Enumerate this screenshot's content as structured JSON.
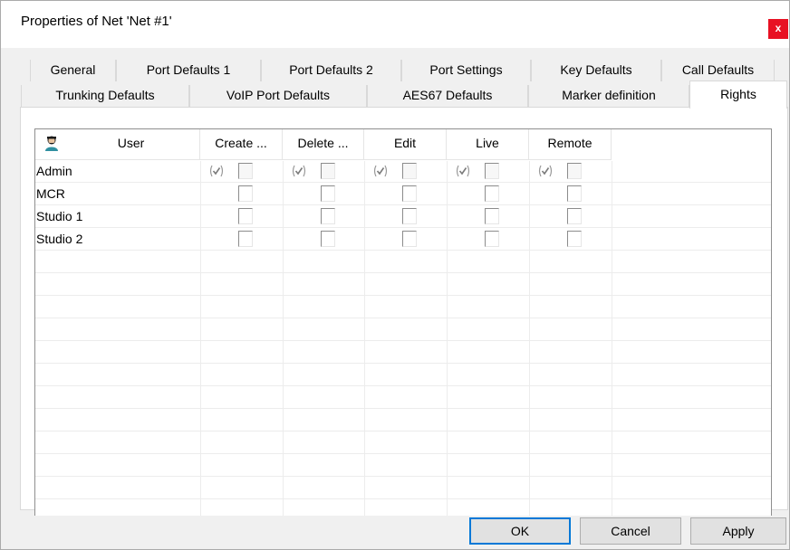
{
  "window": {
    "title": "Properties of Net 'Net #1'",
    "close_label": "x"
  },
  "tabs": {
    "row1": [
      "General",
      "Port Defaults 1",
      "Port Defaults 2",
      "Port Settings",
      "Key Defaults",
      "Call Defaults"
    ],
    "row2": [
      "Trunking Defaults",
      "VoIP Port Defaults",
      "AES67 Defaults",
      "Marker definition"
    ],
    "active": "Rights"
  },
  "rights_table": {
    "headers": [
      "User",
      "Create ...",
      "Delete ...",
      "Edit",
      "Live",
      "Remote"
    ],
    "header_icon": "user-icon",
    "rows": [
      {
        "user": "Admin",
        "inherited": [
          true,
          true,
          true,
          true,
          true
        ],
        "checked": [
          false,
          false,
          false,
          false,
          false
        ],
        "enabled": [
          false,
          false,
          false,
          false,
          false
        ]
      },
      {
        "user": "MCR",
        "inherited": [
          false,
          false,
          false,
          false,
          false
        ],
        "checked": [
          false,
          false,
          false,
          false,
          false
        ],
        "enabled": [
          true,
          true,
          true,
          true,
          true
        ]
      },
      {
        "user": "Studio 1",
        "inherited": [
          false,
          false,
          false,
          false,
          false
        ],
        "checked": [
          false,
          false,
          false,
          false,
          false
        ],
        "enabled": [
          true,
          true,
          true,
          true,
          true
        ]
      },
      {
        "user": "Studio 2",
        "inherited": [
          false,
          false,
          false,
          false,
          false
        ],
        "checked": [
          false,
          false,
          false,
          false,
          false
        ],
        "enabled": [
          true,
          true,
          true,
          true,
          true
        ]
      }
    ],
    "inherit_icon": "inherited-check-icon"
  },
  "buttons": {
    "ok": "OK",
    "cancel": "Cancel",
    "apply": "Apply"
  },
  "colors": {
    "close_button": "#e81123",
    "default_button_border": "#0078d7"
  }
}
